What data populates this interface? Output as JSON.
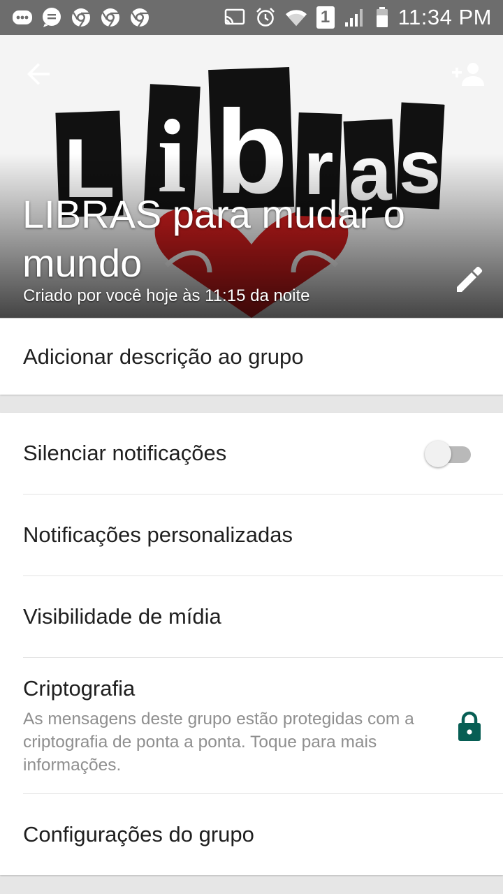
{
  "status_bar": {
    "time": "11:34 PM",
    "sim_slot": "1",
    "left_icons": [
      "messenger-icon",
      "chat-icon",
      "chrome-icon",
      "chrome-icon",
      "chrome-icon"
    ],
    "right_icons": [
      "cast-icon",
      "alarm-icon",
      "wifi-icon",
      "sim-icon",
      "signal-icon",
      "battery-icon"
    ]
  },
  "header": {
    "group_name": "LIBRAS para mudar o mundo",
    "created_text": "Criado por você hoje às 11:15 da noite",
    "image_letters": [
      "L",
      "i",
      "b",
      "r",
      "a",
      "s"
    ],
    "back_icon": "arrow-back-icon",
    "add_icon": "add-person-icon",
    "edit_icon": "pencil-icon"
  },
  "description": {
    "label": "Adicionar descrição ao grupo"
  },
  "settings": {
    "mute_label": "Silenciar notificações",
    "mute_on": false,
    "custom_notifications_label": "Notificações personalizadas",
    "media_visibility_label": "Visibilidade de mídia",
    "encryption_title": "Criptografia",
    "encryption_desc": "As mensagens deste grupo estão protegidas com a criptografia de ponta a ponta. Toque para mais informações.",
    "group_settings_label": "Configurações do grupo"
  },
  "colors": {
    "accent": "#075e54",
    "status_bar": "#6d6d6d",
    "heart": "#d51e1e"
  }
}
